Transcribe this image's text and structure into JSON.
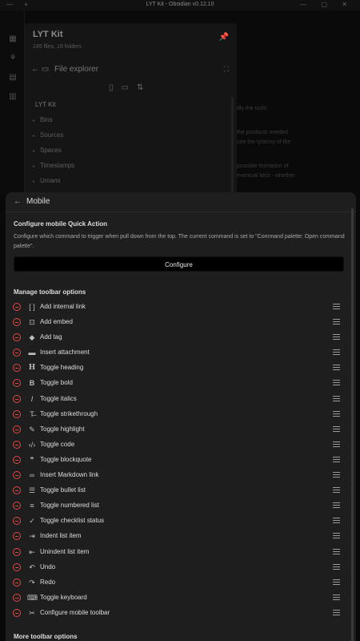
{
  "window": {
    "title": "LYT Kit - Obsidian v0.12.10"
  },
  "background": {
    "vault_name": "LYT Kit",
    "vault_stats": "245 files, 19 folders",
    "file_explorer_label": "File explorer",
    "tree_root": "LYT Kit",
    "tree_items": [
      "Bins",
      "Sources",
      "Spaces",
      "Timestamps",
      "Umami"
    ],
    "obscured_text": [
      "dly the tools",
      "the products needed",
      "see the tyranny of the",
      "possible formation of",
      "eventual best - whether"
    ]
  },
  "sheet": {
    "back_label": "Mobile",
    "quick_action": {
      "title": "Configure mobile Quick Action",
      "description": "Configure which command to trigger when pull down from the top. The current command is set to \"Command palette: Open command palette\".",
      "button_label": "Configure"
    },
    "toolbar_heading": "Manage toolbar options",
    "toolbar_items": [
      {
        "label": "Add internal link",
        "icon": "brackets-icon"
      },
      {
        "label": "Add embed",
        "icon": "embed-icon"
      },
      {
        "label": "Add tag",
        "icon": "tag-icon"
      },
      {
        "label": "Insert attachment",
        "icon": "image-icon"
      },
      {
        "label": "Toggle heading",
        "icon": "heading-icon"
      },
      {
        "label": "Toggle bold",
        "icon": "bold-icon"
      },
      {
        "label": "Toggle italics",
        "icon": "italic-icon"
      },
      {
        "label": "Toggle strikethrough",
        "icon": "strikethrough-icon"
      },
      {
        "label": "Toggle highlight",
        "icon": "highlighter-icon"
      },
      {
        "label": "Toggle code",
        "icon": "code-icon"
      },
      {
        "label": "Toggle blockquote",
        "icon": "quote-icon"
      },
      {
        "label": "Insert Markdown link",
        "icon": "link-icon"
      },
      {
        "label": "Toggle bullet list",
        "icon": "bullet-list-icon"
      },
      {
        "label": "Toggle numbered list",
        "icon": "numbered-list-icon"
      },
      {
        "label": "Toggle checklist status",
        "icon": "check-icon"
      },
      {
        "label": "Indent list item",
        "icon": "indent-icon"
      },
      {
        "label": "Unindent list item",
        "icon": "unindent-icon"
      },
      {
        "label": "Undo",
        "icon": "undo-icon"
      },
      {
        "label": "Redo",
        "icon": "redo-icon"
      },
      {
        "label": "Toggle keyboard",
        "icon": "keyboard-icon"
      },
      {
        "label": "Configure mobile toolbar",
        "icon": "tools-icon"
      }
    ],
    "more_heading": "More toolbar options"
  },
  "colors": {
    "remove_red": "#e04848",
    "sheet_bg": "#1e1e1e",
    "button_bg": "#000000"
  }
}
